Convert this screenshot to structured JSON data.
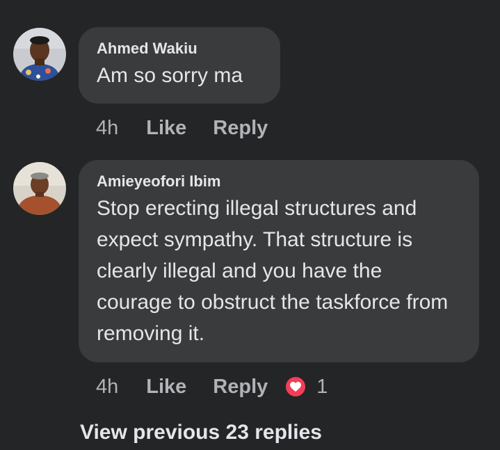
{
  "comments": [
    {
      "author": "Ahmed Wakiu",
      "text": "Am so sorry ma",
      "time": "4h",
      "like_label": "Like",
      "reply_label": "Reply"
    },
    {
      "author": "Amieyeofori Ibim",
      "text": "Stop erecting illegal structures and expect sympathy. That structure is clearly illegal and you have the courage to obstruct the taskforce from removing it.",
      "time": "4h",
      "like_label": "Like",
      "reply_label": "Reply",
      "reaction": {
        "icon": "love-heart-icon",
        "count": "1",
        "color": "#f33e58"
      }
    }
  ],
  "view_previous_label": "View previous 23 replies"
}
